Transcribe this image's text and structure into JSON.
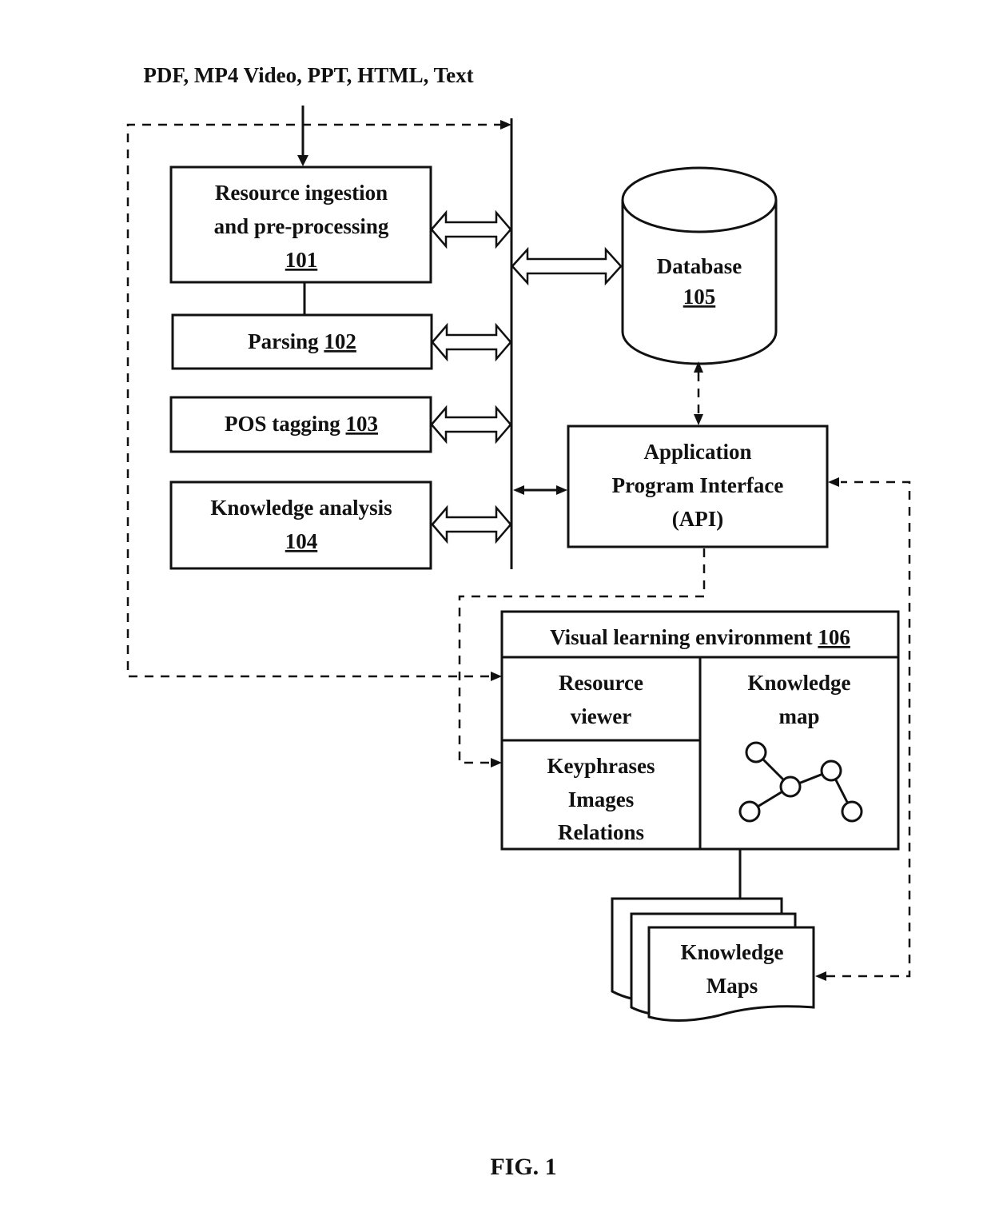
{
  "figure": {
    "caption": "FIG. 1",
    "input_label": "PDF, MP4 Video, PPT, HTML, Text"
  },
  "modules": {
    "ingestion": {
      "line1": "Resource ingestion",
      "line2": "and pre-processing",
      "ref": "101"
    },
    "parsing": {
      "label": "Parsing",
      "ref": "102"
    },
    "pos_tagging": {
      "label": "POS tagging",
      "ref": "103"
    },
    "knowledge_analysis": {
      "label": "Knowledge analysis",
      "ref": "104"
    },
    "database": {
      "label": "Database",
      "ref": "105"
    },
    "api": {
      "line1": "Application",
      "line2": "Program Interface",
      "line3": "(API)"
    },
    "vle": {
      "title": "Visual learning environment",
      "ref": "106",
      "resource_viewer": {
        "line1": "Resource",
        "line2": "viewer"
      },
      "keyphrases_panel": {
        "line1": "Keyphrases",
        "line2": "Images",
        "line3": "Relations"
      },
      "knowledge_map": {
        "line1": "Knowledge",
        "line2": "map"
      }
    },
    "knowledge_maps_docs": {
      "line1": "Knowledge",
      "line2": "Maps"
    }
  }
}
